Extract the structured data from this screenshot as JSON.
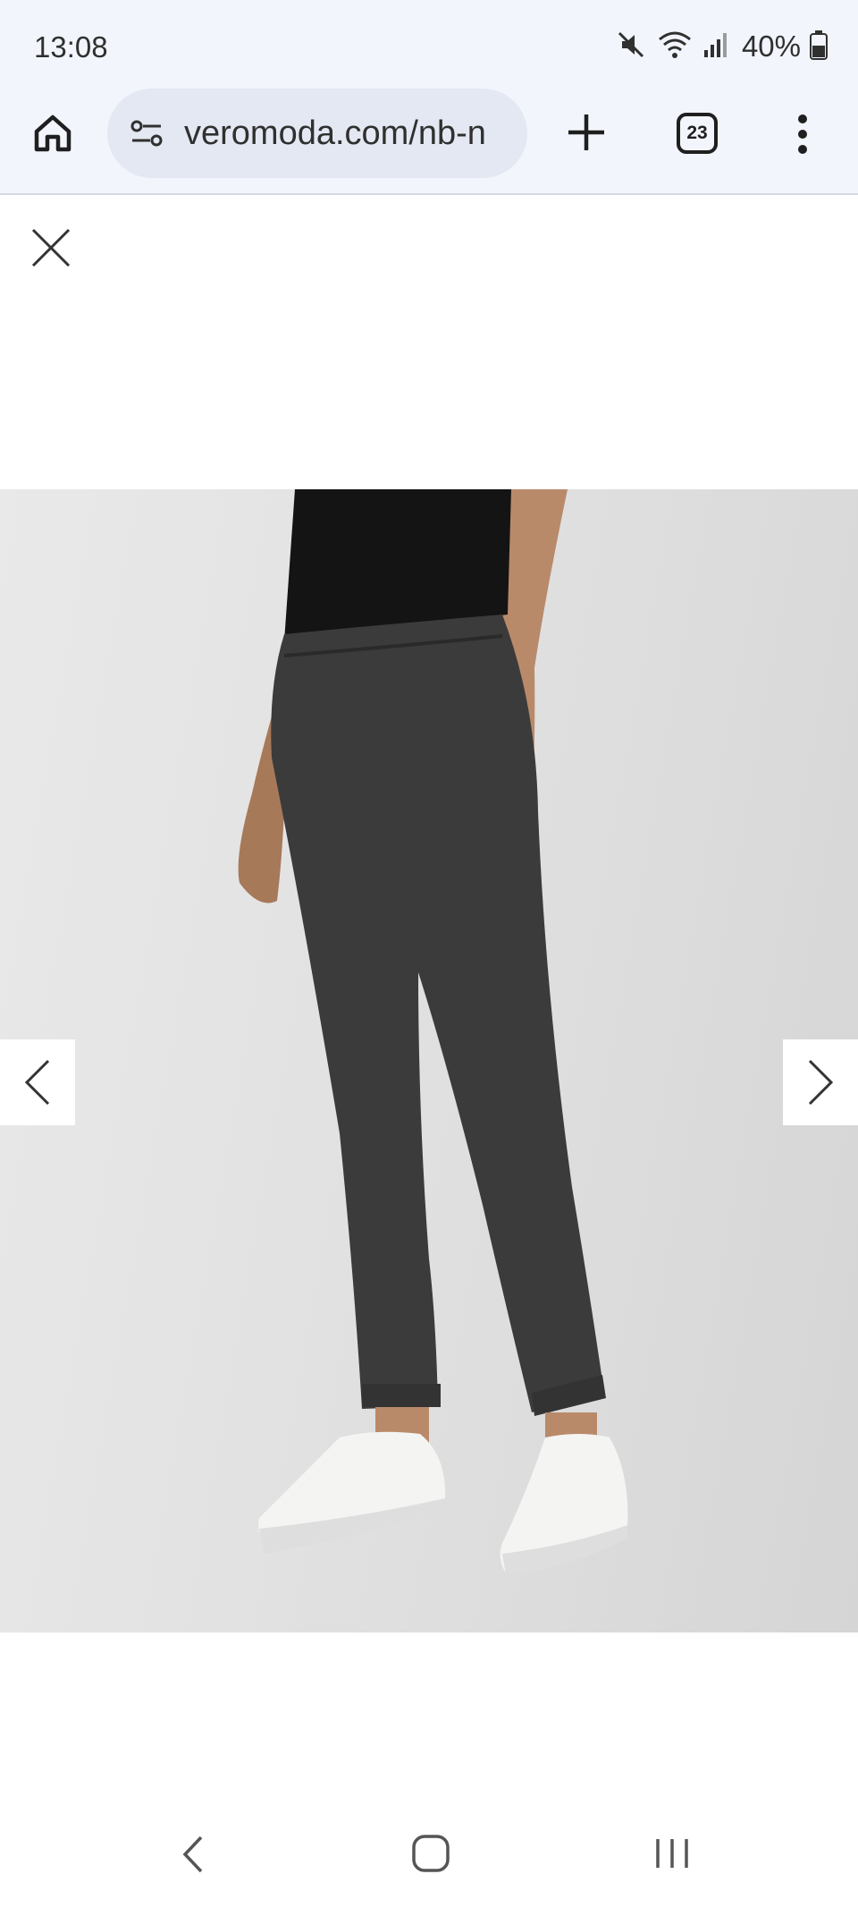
{
  "status_bar": {
    "time": "13:08",
    "battery_percent": "40%",
    "icons": [
      "mute-icon",
      "wifi-icon",
      "signal-icon",
      "battery-icon"
    ]
  },
  "browser": {
    "url": "veromoda.com/nb-n",
    "tab_count": "23",
    "icons": [
      "home-icon",
      "site-settings-icon",
      "new-tab-icon",
      "tab-switcher-icon",
      "more-menu-icon"
    ]
  },
  "gallery": {
    "close_icon": "close-icon",
    "prev_icon": "chevron-left-icon",
    "next_icon": "chevron-right-icon",
    "image_subject": "product-photo"
  },
  "system_nav": {
    "icons": [
      "back-icon",
      "home-icon",
      "recents-icon"
    ]
  },
  "colors": {
    "chrome_background": "#f2f5fb",
    "url_pill": "#e3e8f2",
    "photo_background": "#e2e2e2",
    "trousers": "#3b3b3b",
    "top": "#141414"
  }
}
